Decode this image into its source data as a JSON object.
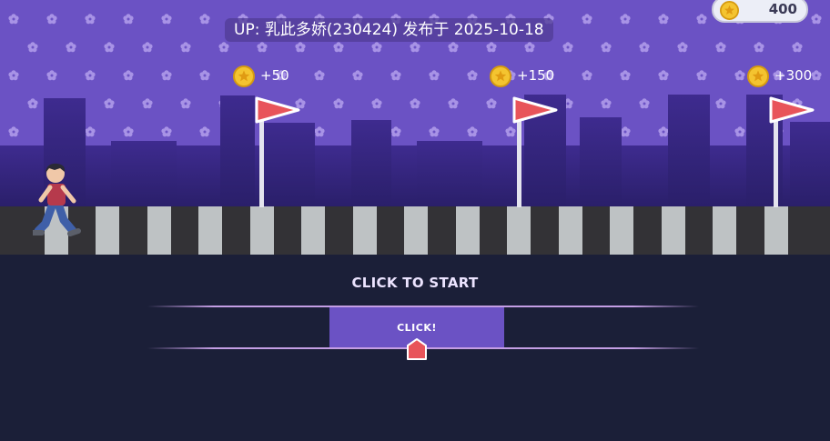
{
  "credit": {
    "text": "UP: 乳此多娇(230424) 发布于 2025-10-18"
  },
  "coins": {
    "count": "400",
    "icon": "coin-icon"
  },
  "milestones": [
    {
      "label": "+50",
      "icon": "coin-icon"
    },
    {
      "label": "+150",
      "icon": "coin-icon"
    },
    {
      "label": "+300",
      "icon": "coin-icon"
    }
  ],
  "controls": {
    "prompt": "CLICK TO START",
    "button_label": "CLICK!"
  },
  "colors": {
    "sky": "#6b52c4",
    "skyline": "#3a2886",
    "road": "#333236",
    "stripe": "#bec2c4",
    "flag": "#e8545a",
    "ground": "#1b1f38",
    "rail": "#c49ee4"
  }
}
